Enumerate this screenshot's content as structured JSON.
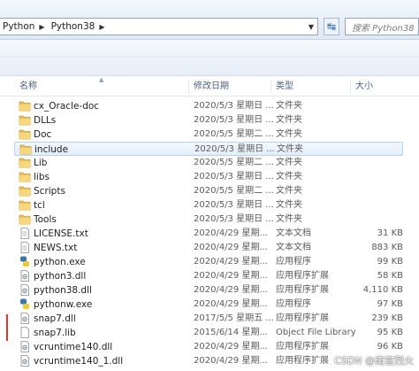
{
  "address_bar": {
    "crumbs": [
      "Python",
      "Python38"
    ]
  },
  "search": {
    "placeholder": "搜索 Python38"
  },
  "columns": {
    "name": "名称",
    "date": "修改日期",
    "type": "类型",
    "size": "大小"
  },
  "files": [
    {
      "name": "cx_Oracle-doc",
      "date": "2020/5/3 星期日 ...",
      "type": "文件夹",
      "size": "",
      "icon": "folder-icon"
    },
    {
      "name": "DLLs",
      "date": "2020/5/3 星期日 ...",
      "type": "文件夹",
      "size": "",
      "icon": "folder-icon"
    },
    {
      "name": "Doc",
      "date": "2020/5/5 星期二 ...",
      "type": "文件夹",
      "size": "",
      "icon": "folder-icon"
    },
    {
      "name": "include",
      "date": "2020/5/3 星期日 ...",
      "type": "文件夹",
      "size": "",
      "icon": "folder-icon",
      "selected": true
    },
    {
      "name": "Lib",
      "date": "2020/5/5 星期二 ...",
      "type": "文件夹",
      "size": "",
      "icon": "folder-icon"
    },
    {
      "name": "libs",
      "date": "2020/5/3 星期日 ...",
      "type": "文件夹",
      "size": "",
      "icon": "folder-icon"
    },
    {
      "name": "Scripts",
      "date": "2020/5/5 星期二 ...",
      "type": "文件夹",
      "size": "",
      "icon": "folder-icon"
    },
    {
      "name": "tcl",
      "date": "2020/5/3 星期日 ...",
      "type": "文件夹",
      "size": "",
      "icon": "folder-icon"
    },
    {
      "name": "Tools",
      "date": "2020/5/3 星期日 ...",
      "type": "文件夹",
      "size": "",
      "icon": "folder-icon"
    },
    {
      "name": "LICENSE.txt",
      "date": "2020/4/29 星期...",
      "type": "文本文档",
      "size": "31 KB",
      "icon": "text-file-icon"
    },
    {
      "name": "NEWS.txt",
      "date": "2020/4/29 星期...",
      "type": "文本文档",
      "size": "883 KB",
      "icon": "text-file-icon"
    },
    {
      "name": "python.exe",
      "date": "2020/4/29 星期...",
      "type": "应用程序",
      "size": "99 KB",
      "icon": "python-exe-icon"
    },
    {
      "name": "python3.dll",
      "date": "2020/4/29 星期...",
      "type": "应用程序扩展",
      "size": "58 KB",
      "icon": "dll-file-icon"
    },
    {
      "name": "python38.dll",
      "date": "2020/4/29 星期...",
      "type": "应用程序扩展",
      "size": "4,110 KB",
      "icon": "dll-file-icon"
    },
    {
      "name": "pythonw.exe",
      "date": "2020/4/29 星期...",
      "type": "应用程序",
      "size": "97 KB",
      "icon": "python-exe-icon"
    },
    {
      "name": "snap7.dll",
      "date": "2017/5/5 星期五 ...",
      "type": "应用程序扩展",
      "size": "239 KB",
      "icon": "dll-file-icon"
    },
    {
      "name": "snap7.lib",
      "date": "2015/6/14 星期...",
      "type": "Object File Library",
      "size": "95 KB",
      "icon": "lib-file-icon"
    },
    {
      "name": "vcruntime140.dll",
      "date": "2020/4/29 星期...",
      "type": "应用程序扩展",
      "size": "96 KB",
      "icon": "dll-file-icon"
    },
    {
      "name": "vcruntime140_1.dll",
      "date": "2020/4/29 星期...",
      "type": "应用程序扩展",
      "size": "",
      "icon": "dll-file-icon"
    }
  ],
  "watermark": "CSDN @南宫烈火"
}
